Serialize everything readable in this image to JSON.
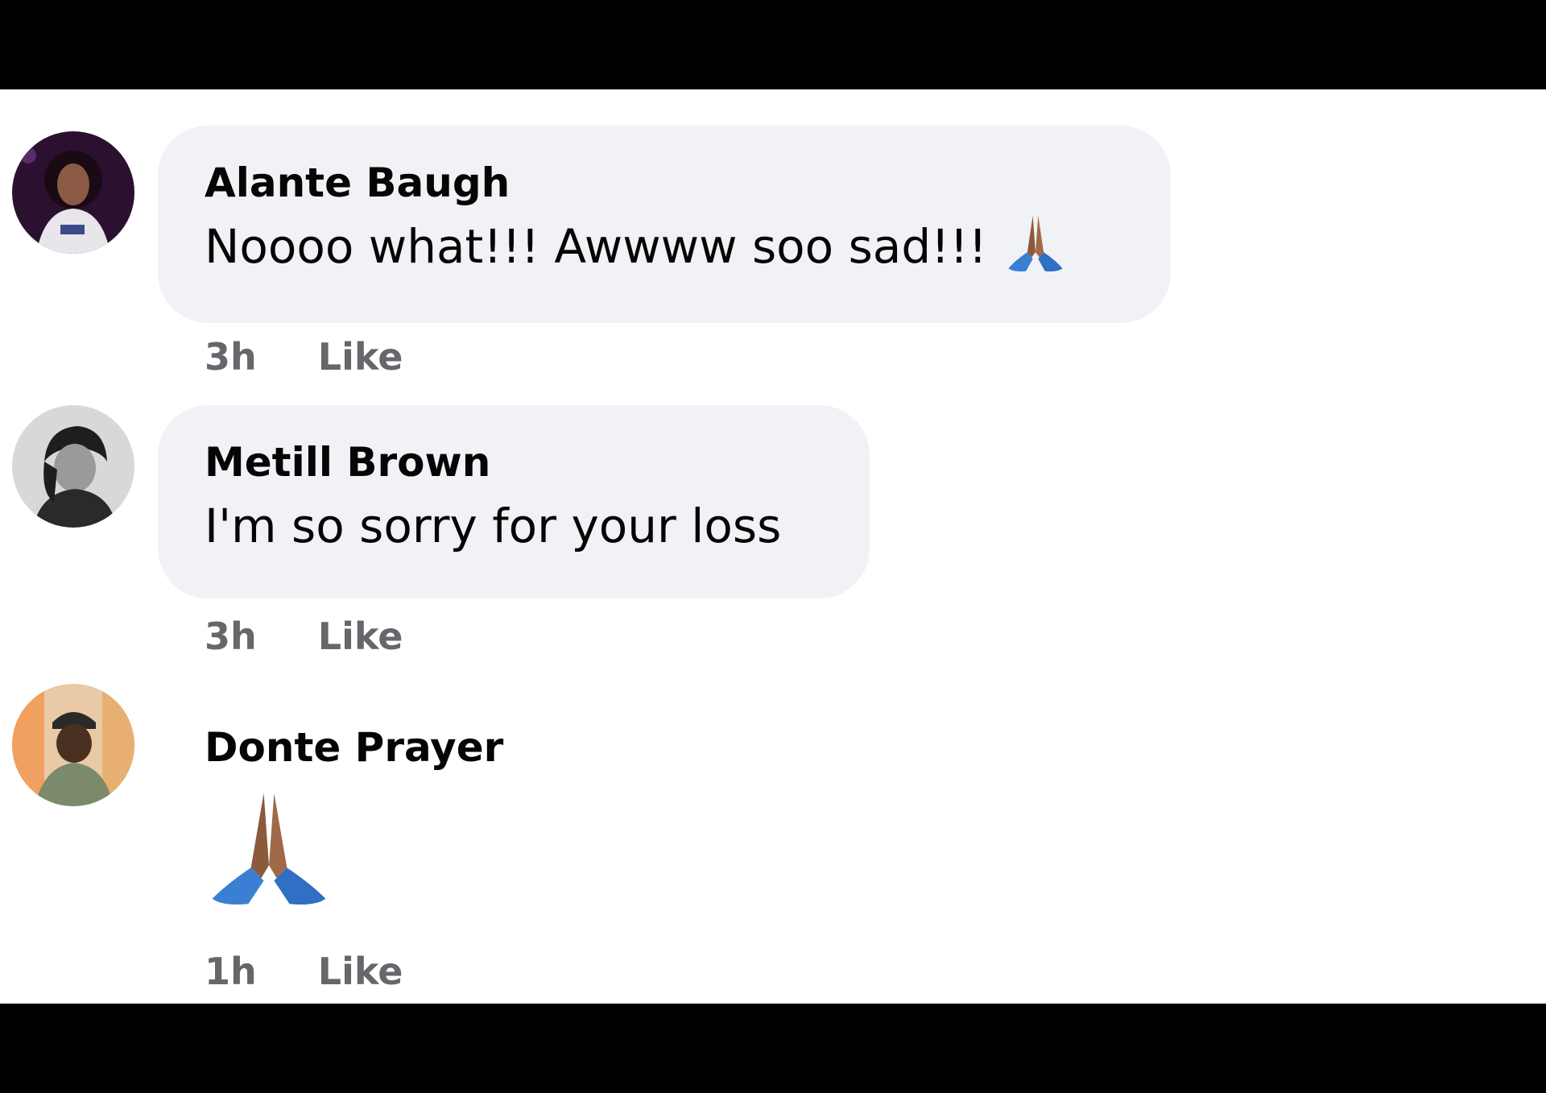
{
  "comments": [
    {
      "author": "Alante Baugh",
      "text": "Noooo what!!! Awwww soo sad!!!",
      "emoji": "folded-hands-icon",
      "time": "3h",
      "like_label": "Like"
    },
    {
      "author": "Metill Brown",
      "text": "I'm so sorry for your loss",
      "time": "3h",
      "like_label": "Like"
    },
    {
      "author": "Donte Prayer",
      "emoji": "folded-hands-icon",
      "time": "1h",
      "like_label": "Like"
    }
  ],
  "colors": {
    "bubble": "#f0f2f5",
    "meta_text": "#65676b",
    "name_text": "#050505"
  }
}
